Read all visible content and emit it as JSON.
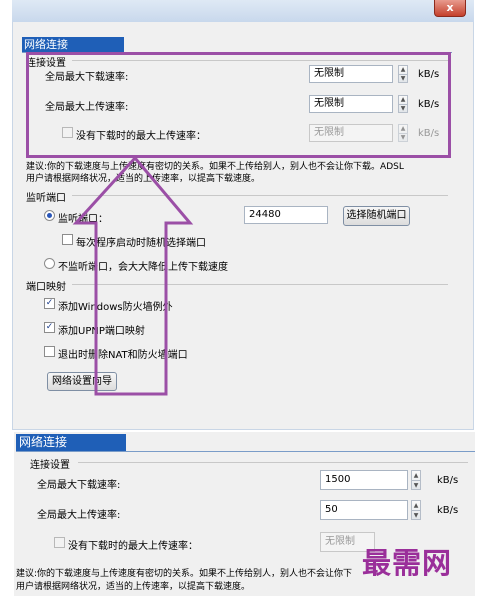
{
  "window_top": {
    "close_glyph": "x",
    "panel_title": "网络连接",
    "connection_settings": {
      "group_title": "连接设置",
      "max_download_label": "全局最大下载速率:",
      "max_download_value": "无限制",
      "max_upload_label": "全局最大上传速率:",
      "max_upload_value": "无限制",
      "no_download_upload_label": "没有下载时的最大上传速率：",
      "no_download_upload_value": "无限制",
      "unit": "kB/s"
    },
    "advice_line1": "建议:你的下载速度与上传速度有密切的关系。如果不上传给别人，别人也不会让你下载。ADSL",
    "advice_line2": "用户请根据网络状况，适当的上传速率，以提高下载速度。",
    "listen_port": {
      "group_title": "监听端口",
      "listen_radio_label": "监听端口：",
      "port_value": "24480",
      "random_port_button": "选择随机端口",
      "random_on_start_label": "每次程序启动时随机选择端口",
      "no_listen_radio_label": "不监听端口，会大大降低上传下载速度"
    },
    "port_mapping": {
      "group_title": "端口映射",
      "windows_firewall_label": "添加Windows防火墙例外",
      "upnp_label": "添加UPNP端口映射",
      "remove_on_exit_label": "退出时删除NAT和防火墙端口"
    },
    "network_wizard_button": "网络设置向导"
  },
  "window_bottom": {
    "panel_title": "网络连接",
    "group_title": "连接设置",
    "max_download_label": "全局最大下载速率:",
    "max_download_value": "1500",
    "max_upload_label": "全局最大上传速率:",
    "max_upload_value": "50",
    "no_download_upload_label": "没有下载时的最大上传速率：",
    "no_download_upload_value": "无限制",
    "unit": "kB/s",
    "advice_line1": "建议:你的下载速度与上传速度有密切的关系。如果不上传给别人，别人也不会让你下",
    "advice_line2": "用户请根据网络状况，适当的上传速率，以提高下载速度。"
  },
  "check_glyph": "✓",
  "spin_up_glyph": "▲",
  "spin_down_glyph": "▼",
  "watermark": "最需网",
  "colors": {
    "highlight": "#9b4fa6",
    "panel_title_bg": "#1f5fb7",
    "watermark": "#9a2f9a"
  }
}
